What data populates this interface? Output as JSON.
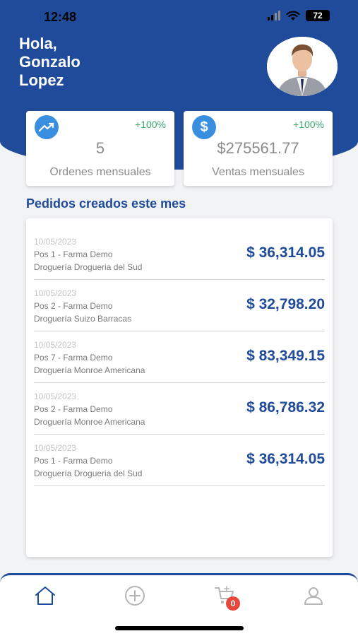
{
  "status_bar": {
    "time": "12:48",
    "battery": "72"
  },
  "header": {
    "greeting_line1": "Hola,",
    "greeting_line2": "Gonzalo",
    "greeting_line3": "Lopez"
  },
  "stats": [
    {
      "icon": "trending-up-icon",
      "change": "+100%",
      "value": "5",
      "label": "Ordenes mensuales"
    },
    {
      "icon": "dollar-icon",
      "change": "+100%",
      "value": "$275561.77",
      "label": "Ventas mensuales"
    }
  ],
  "section_title": "Pedidos creados este mes",
  "orders": [
    {
      "date": "10/05/2023",
      "pos": "Pos 1 - Farma Demo",
      "drogueria": "Droguería Drogueria del Sud",
      "amount": "$ 36,314.05"
    },
    {
      "date": "10/05/2023",
      "pos": "Pos 2 - Farma Demo",
      "drogueria": "Droguería Suizo Barracas",
      "amount": "$ 32,798.20"
    },
    {
      "date": "10/05/2023",
      "pos": "Pos 7 - Farma Demo",
      "drogueria": "Droguería Monroe Americana",
      "amount": "$ 83,349.15"
    },
    {
      "date": "10/05/2023",
      "pos": "Pos 2 - Farma Demo",
      "drogueria": "Droguería Monroe Americana",
      "amount": "$ 86,786.32"
    },
    {
      "date": "10/05/2023",
      "pos": "Pos 1 - Farma Demo",
      "drogueria": "Droguería Drogueria del Sud",
      "amount": "$ 36,314.05"
    }
  ],
  "bottom_nav": {
    "items": [
      "home-icon",
      "add-circle-icon",
      "cart-icon",
      "user-icon"
    ],
    "cart_badge": "0"
  },
  "colors": {
    "primary": "#1f4b9a",
    "accent_icon": "#3a8ee0",
    "positive": "#3aaa6e",
    "badge": "#e8463b"
  }
}
